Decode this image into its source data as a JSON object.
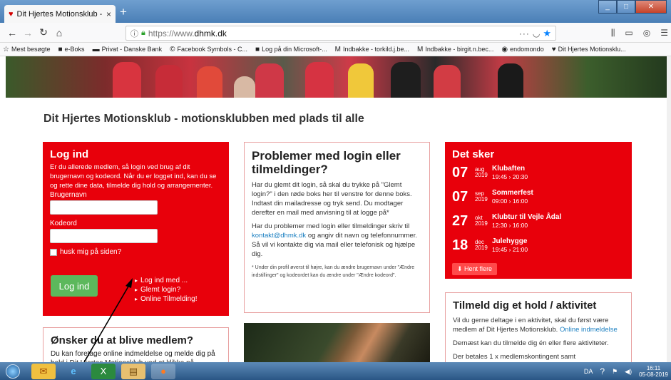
{
  "browser": {
    "tab_title": "Dit Hjertes Motionsklub - moti",
    "tab_close": "×",
    "new_tab": "+",
    "url_protocol": "https://www.",
    "url_host": "dhmk.dk",
    "url_dots": "···",
    "bookmarks": [
      {
        "icon": "☆",
        "label": "Mest besøgte"
      },
      {
        "icon": "■",
        "label": "e-Boks"
      },
      {
        "icon": "▬",
        "label": "Privat - Danske Bank"
      },
      {
        "icon": "©",
        "label": "Facebook Symbols - C..."
      },
      {
        "icon": "■",
        "label": "Log på din Microsoft-..."
      },
      {
        "icon": "M",
        "label": "Indbakke - torkild.j.be..."
      },
      {
        "icon": "M",
        "label": "Indbakke - birgit.n.bec..."
      },
      {
        "icon": "◉",
        "label": "endomondo"
      },
      {
        "icon": "♥",
        "label": "Dit Hjertes Motionsklu..."
      }
    ]
  },
  "page": {
    "headline": "Dit Hjertes Motionsklub - motionsklubben med plads til alle",
    "login": {
      "title": "Log ind",
      "intro": "Er du allerede medlem, så login ved brug af dit brugernavn og kodeord. Når du er logget ind, kan du se og rette dine data, tilmelde dig hold og arrangementer.",
      "username_label": "Brugernavn",
      "password_label": "Kodeord",
      "remember_label": "husk mig på siden?",
      "button": "Log ind",
      "links": [
        "Log ind med ...",
        "Glemt login?",
        "Online Tilmelding!"
      ]
    },
    "member": {
      "title": "Ønsker du at blive medlem?",
      "text": "Du kan foretage online indmeldelse og melde dig på hold i Dit Hjertes Motionsklub ved at klikke på"
    },
    "problems": {
      "title": "Problemer med login eller tilmeldinger?",
      "p1": "Har du glemt dit login, så skal du trykke på \"Glemt login?\" i den røde boks her til venstre for denne boks. Indtast din mailadresse og tryk send. Du modtager derefter en mail med anvisning til at logge på*",
      "p2_before": "Har du problemer med login eller tilmeldinger skriv til ",
      "p2_link": "kontakt@dhmk.dk",
      "p2_after": " og angiv dit navn og telefonnummer. Så vil vi kontakte dig via mail eller telefonisk og hjælpe dig.",
      "footnote": "* Under din profil øverst til højre, kan du ændre brugernavn under \"Ændre indstillinger\" og kodeordet kan du ændre under \"Ændre kodeord\"."
    },
    "events": {
      "title": "Det sker",
      "items": [
        {
          "day": "07",
          "month": "aug",
          "year": "2019",
          "name": "Klubaften",
          "time": "19:45 › 20:30"
        },
        {
          "day": "07",
          "month": "sep",
          "year": "2019",
          "name": "Sommerfest",
          "time": "09:00 › 16:00"
        },
        {
          "day": "27",
          "month": "okt",
          "year": "2019",
          "name": "Klubtur til Vejle Ådal",
          "time": "12:30 › 16:00"
        },
        {
          "day": "18",
          "month": "dec",
          "year": "2019",
          "name": "Julehygge",
          "time": "19:45 › 21:00"
        }
      ],
      "more": "Hent flere"
    },
    "join": {
      "title": "Tilmeld dig et hold / aktivitet",
      "p1_before": "Vil du gerne deltage i en aktivitet, skal du først være medlem af Dit Hjertes Motionsklub. ",
      "p1_link": "Online indmeldelse",
      "p2": "Dernæst kan du tilmelde dig én eller flere aktiviteter.",
      "p3": "Der betales 1 x medlemskontingent samt"
    }
  },
  "taskbar": {
    "lang": "DA",
    "time": "16:11",
    "date": "05-08-2019"
  }
}
